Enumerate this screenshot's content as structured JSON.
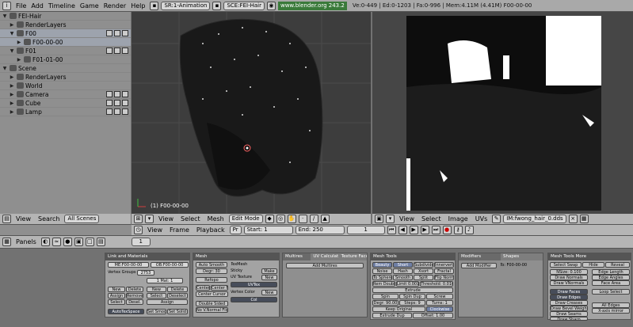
{
  "topbar": {
    "menus": [
      "File",
      "Add",
      "Timeline",
      "Game",
      "Render",
      "Help"
    ],
    "screen": "SR:1-Animation",
    "scene": "SCE:FEI-Hair",
    "url": "www.blender.org 243.2",
    "stats": "Ve:0-449 | Ed:0-1203 | Fa:0-996 | Mem:4.11M (4.41M) F00-00-00"
  },
  "outliner": {
    "rows": [
      {
        "label": "FEI-Hair",
        "indent": 0,
        "expanded": true,
        "icons": false,
        "sel": false
      },
      {
        "label": "RenderLayers",
        "indent": 1,
        "expanded": false,
        "icons": false,
        "sel": false
      },
      {
        "label": "F00",
        "indent": 1,
        "expanded": true,
        "icons": true,
        "sel": true
      },
      {
        "label": "F00-00-00",
        "indent": 2,
        "expanded": false,
        "icons": false,
        "sel": true
      },
      {
        "label": "F01",
        "indent": 1,
        "expanded": true,
        "icons": true,
        "sel": false
      },
      {
        "label": "F01-01-00",
        "indent": 2,
        "expanded": false,
        "icons": false,
        "sel": false
      },
      {
        "label": "Scene",
        "indent": 0,
        "expanded": true,
        "icons": false,
        "sel": false
      },
      {
        "label": "RenderLayers",
        "indent": 1,
        "expanded": false,
        "icons": false,
        "sel": false
      },
      {
        "label": "World",
        "indent": 1,
        "expanded": false,
        "icons": false,
        "sel": false
      },
      {
        "label": "Camera",
        "indent": 1,
        "expanded": false,
        "icons": true,
        "sel": false
      },
      {
        "label": "Cube",
        "indent": 1,
        "expanded": false,
        "icons": true,
        "sel": false
      },
      {
        "label": "Lamp",
        "indent": 1,
        "expanded": false,
        "icons": true,
        "sel": false
      }
    ],
    "header": {
      "view": "View",
      "search": "Search",
      "scope": "All Scenes"
    }
  },
  "view3d": {
    "frame_label": "(1) F00-00-00",
    "header": {
      "view": "View",
      "select": "Select",
      "mesh": "Mesh",
      "mode": "Edit Mode"
    }
  },
  "image_editor": {
    "header": {
      "view": "View",
      "select": "Select",
      "image": "Image",
      "uvs": "UVs",
      "image_name": "IM:fwong_hair_0.dds"
    }
  },
  "timeline": {
    "view": "View",
    "frame": "Frame",
    "playback": "Playback",
    "pr": "Pr",
    "start": "Start: 1",
    "end": "End: 250",
    "current": "1"
  },
  "buttons_header": {
    "panels": "Panels",
    "frame": "1"
  },
  "panels": {
    "link": {
      "title": "Link and Materials",
      "me": "ME:F00-00-00",
      "ob": "OB:F00-00-00",
      "vgroups": "Vertex Groups",
      "vgroup_count": "2753",
      "mat": "1 Mat: 1",
      "buttons": [
        "New",
        "Delete",
        "Assign",
        "Remove",
        "Select",
        "Desel."
      ],
      "mat_buttons": [
        "New",
        "Delete",
        "Select",
        "Deselect",
        "Assign"
      ],
      "autotex": "AutoTexSpace",
      "set_smooth": "Set Smooth",
      "set_solid": "Set Solid"
    },
    "mesh": {
      "title": "Mesh",
      "auto_smooth": "Auto Smooth",
      "degr": "Degr: 30",
      "refopo": "Refopo",
      "center": "Center",
      "center_new": "Center New",
      "center_cursor": "Center Cursor",
      "double_sided": "Double Sided",
      "no_vnormal": "No V.Normal Flip",
      "texmesh": "TexMesh",
      "sticky": "Sticky",
      "make": "Make",
      "uv_texture": "UV Texture",
      "new": "New",
      "uvtex": "UVTex",
      "vertex_color": "Vertex Color",
      "col": "Col"
    },
    "multires": {
      "tabs": [
        "Multires",
        "UV Calculat",
        "Texture Face"
      ],
      "add": "Add Multires"
    },
    "mesh_tools": {
      "title": "Mesh Tools",
      "rows": [
        [
          "Beauty",
          "Short",
          "Subdivide",
          "Innervert"
        ],
        [
          "Noise",
          "Hash",
          "Xsort",
          "Fractal"
        ],
        [
          "To Sphere",
          "Smooth",
          "Split",
          "Flip Normal"
        ],
        [
          "Rem Doubles",
          "Limit 0.001",
          "Threshold: 0.010"
        ]
      ],
      "extrude": "Extrude",
      "spin": "Spin",
      "spin_dup": "Spin Dup",
      "screw": "Screw",
      "degr": "Degr: 90.00",
      "steps": "Steps: 9",
      "turns": "Turns: 1",
      "keep_original": "Keep Original",
      "clockwise": "Clockwise",
      "extrude_dup": "Extrude Dup",
      "offset": "Offset: 1.00",
      "join_triangles": "Join triangles",
      "threshold": "Threshold 0.800",
      "delimit": [
        "Delimit UV",
        "Delimit Vcol",
        "Delimit Sharp",
        "Delimit Mat"
      ]
    },
    "modifiers": {
      "tabs": [
        "Modifiers",
        "Shapes"
      ],
      "add": "Add Modifier",
      "to": "To: F00-00-00"
    },
    "mesh_tools_more": {
      "title": "Mesh Tools More",
      "top": [
        "Select Swap",
        "Hide",
        "Reveal"
      ],
      "nsize": "NSize: 0.100",
      "draw_normals": "Draw Normals",
      "draw_vnormals": "Draw VNormals",
      "edge_length": "Edge Length",
      "edge_angles": "Edge Angles",
      "face_area": "Face Area",
      "loop_select": "Loop Select",
      "draw": [
        "Draw Faces",
        "Draw Edges",
        "Draw Creases",
        "Draw Bevel Weights",
        "Draw Seams",
        "Draw Sharp"
      ],
      "all_edges": "All Edges",
      "x_axis_mirror": "X-axis mirror"
    }
  },
  "colors": {
    "accent_blue": "#6f7fa5",
    "header_gray": "#b5b5b5",
    "view_bg": "#3d3d3d"
  }
}
